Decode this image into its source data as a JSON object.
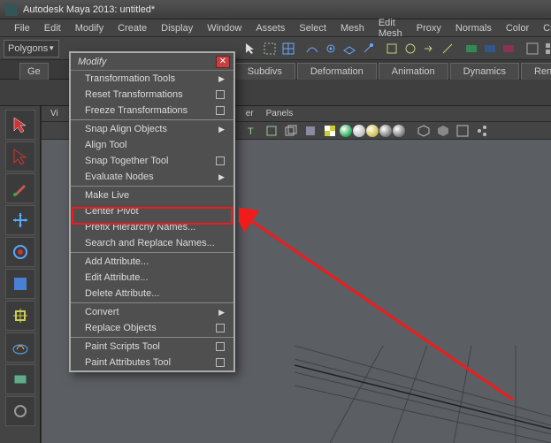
{
  "title": "Autodesk Maya 2013: untitled*",
  "menubar": [
    "File",
    "Edit",
    "Modify",
    "Create",
    "Display",
    "Window",
    "Assets",
    "Select",
    "Mesh",
    "Edit Mesh",
    "Proxy",
    "Normals",
    "Color",
    "Crea"
  ],
  "mode_dropdown": "Polygons",
  "shelf_tabs": [
    "Ge",
    "Subdivs",
    "Deformation",
    "Animation",
    "Dynamics",
    "Render"
  ],
  "viewport_menus": [
    "Vi",
    "er",
    "Panels"
  ],
  "modify_menu": {
    "title": "Modify",
    "items": [
      {
        "label": "Transformation Tools",
        "type": "sub"
      },
      {
        "label": "Reset Transformations",
        "type": "opt"
      },
      {
        "label": "Freeze Transformations",
        "type": "opt"
      },
      {
        "sep": true
      },
      {
        "label": "Snap Align Objects",
        "type": "sub"
      },
      {
        "label": "Align Tool",
        "type": "plain"
      },
      {
        "label": "Snap Together Tool",
        "type": "opt"
      },
      {
        "label": "Evaluate Nodes",
        "type": "sub"
      },
      {
        "sep": true
      },
      {
        "label": "Make Live",
        "type": "plain"
      },
      {
        "label": "Center Pivot",
        "type": "plain"
      },
      {
        "label": "Prefix Hierarchy Names...",
        "type": "plain"
      },
      {
        "label": "Search and Replace Names...",
        "type": "plain"
      },
      {
        "sep": true
      },
      {
        "label": "Add Attribute...",
        "type": "plain"
      },
      {
        "label": "Edit Attribute...",
        "type": "plain"
      },
      {
        "label": "Delete Attribute...",
        "type": "plain"
      },
      {
        "sep": true
      },
      {
        "label": "Convert",
        "type": "sub"
      },
      {
        "label": "Replace Objects",
        "type": "opt"
      },
      {
        "sep": true
      },
      {
        "label": "Paint Scripts Tool",
        "type": "opt"
      },
      {
        "label": "Paint Attributes Tool",
        "type": "opt"
      }
    ]
  },
  "colors": {
    "highlight": "#f21b1b"
  }
}
